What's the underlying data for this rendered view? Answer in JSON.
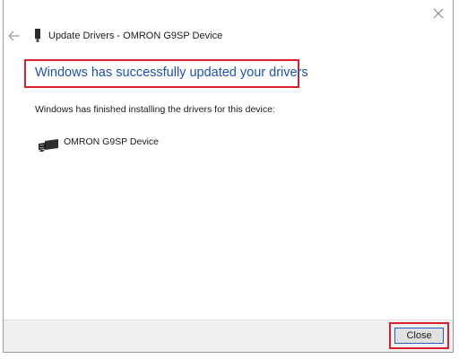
{
  "window": {
    "title": "Update Drivers - OMRON G9SP Device",
    "close_icon": "close-icon",
    "back_icon": "back-arrow-icon",
    "title_icon": "usb-device-icon"
  },
  "main": {
    "headline": "Windows has successfully updated your drivers",
    "subtext": "Windows has finished installing the drivers for this device:",
    "device_icon": "usb-cable-icon",
    "device_name": "OMRON G9SP Device"
  },
  "footer": {
    "close_label": "Close"
  },
  "colors": {
    "headline": "#1f4fb3",
    "highlight": "#d9212c",
    "footer_bg": "#f0f0f0"
  }
}
